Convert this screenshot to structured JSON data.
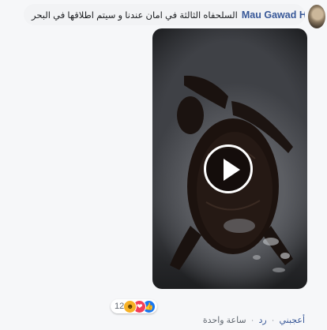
{
  "comment": {
    "author": "Mau Gawad Hamada",
    "text": "السلحفاه الثالثة في امان عندنا و سيتم اطلاقها في البحر",
    "avatar_icon": "profile-photo"
  },
  "video": {
    "play_icon": "play-icon"
  },
  "reactions": {
    "count": "12",
    "icons": [
      "like-icon",
      "love-icon",
      "haha-icon"
    ]
  },
  "actions": {
    "like": "أعجبني",
    "reply": "رد",
    "separator": "·",
    "time": "ساعة واحدة"
  },
  "colors": {
    "link": "#385898",
    "bubble": "#f2f3f5",
    "background": "#f6f7f9"
  }
}
